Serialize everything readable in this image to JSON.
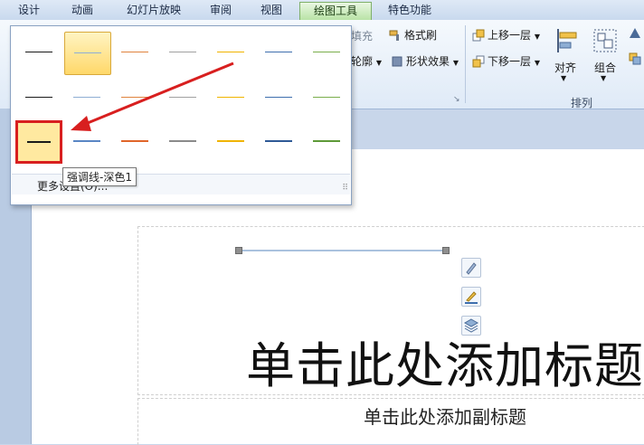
{
  "tabs": [
    {
      "label": "设计"
    },
    {
      "label": "动画"
    },
    {
      "label": "幻灯片放映"
    },
    {
      "label": "审阅"
    },
    {
      "label": "视图"
    },
    {
      "label": "绘图工具",
      "active": true
    },
    {
      "label": "特色功能"
    }
  ],
  "ribbon": {
    "fill_label": "填充",
    "format_painter_label": "格式刷",
    "outline_label": "轮廓",
    "shape_effects_label": "形状效果",
    "bring_forward_label": "上移一层",
    "send_backward_label": "下移一层",
    "align_label": "对齐",
    "group_label": "组合",
    "arrange_group_label": "排列"
  },
  "dropdown": {
    "more_settings_label": "更多设置(O)...",
    "tooltip": "强调线-深色1",
    "line_colors": [
      "#1a1a1a",
      "#8eaed4",
      "#e0833e",
      "#a0a0a0",
      "#f0b400",
      "#3f6fae",
      "#7aae4c"
    ]
  },
  "slide": {
    "title_placeholder": "单击此处添加标题",
    "subtitle_placeholder": "单击此处添加副标题"
  }
}
